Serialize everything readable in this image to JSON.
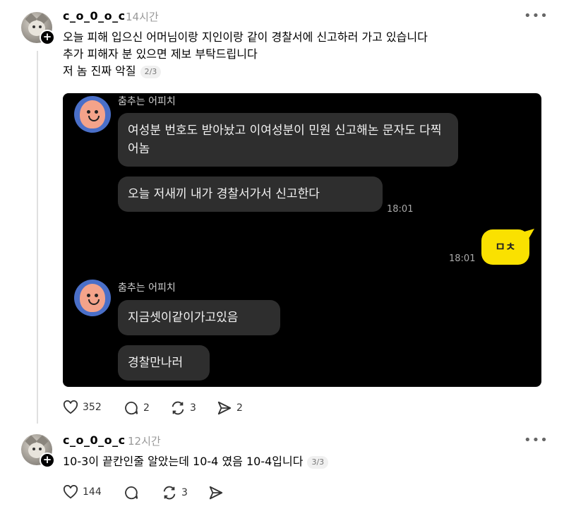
{
  "post1": {
    "username": "c_o_0_o_c",
    "time": "14시간",
    "more": "•••",
    "lines": [
      "오늘 피해 입으신 어머님이랑 지인이랑 같이 경찰서에 신고하러 가고 있습니다",
      "추가 피해자 분 있으면 제보 부탁드립니다",
      "저 놈 진짜 악질"
    ],
    "pager": "2/3",
    "screenshot": {
      "sender1": "춤추는 어피치",
      "bubble1": "여성분 번호도 받아놨고 이여성분이 민원 신고해논 문자도 다찍어놈",
      "bubble2": "오늘 저새끼 내가 경찰서가서 신고한다",
      "time1": "18:01",
      "my_bubble": "ㅁㅊ",
      "time2": "18:01",
      "sender2": "춤추는 어피치",
      "bubble3": "지금셋이같이가고있음",
      "bubble4": "경찰만나러"
    },
    "actions": {
      "likes": "352",
      "comments": "2",
      "reposts": "3",
      "shares": "2"
    }
  },
  "post2": {
    "username": "c_o_0_o_c",
    "time": "12시간",
    "more": "•••",
    "text": "10-3이 끝칸인줄 알았는데 10-4 였음 10-4입니다",
    "pager": "3/3",
    "actions": {
      "likes": "144",
      "reposts": "3"
    }
  }
}
